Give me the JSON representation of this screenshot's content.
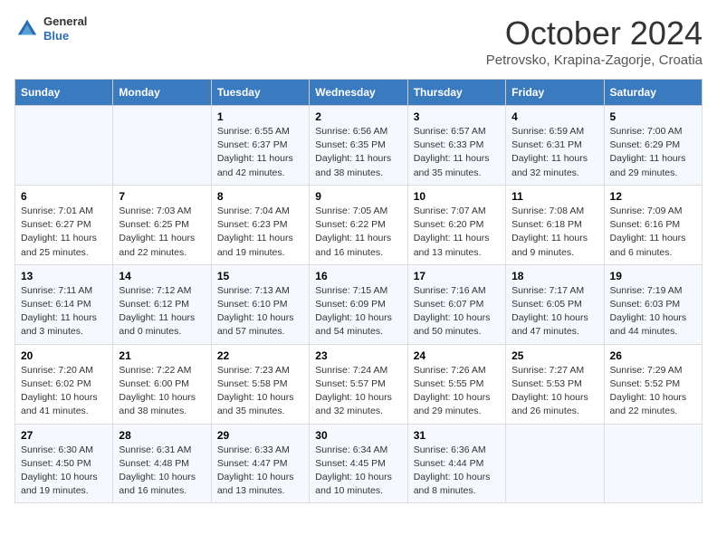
{
  "header": {
    "logo_general": "General",
    "logo_blue": "Blue",
    "month_title": "October 2024",
    "location": "Petrovsko, Krapina-Zagorje, Croatia"
  },
  "days_of_week": [
    "Sunday",
    "Monday",
    "Tuesday",
    "Wednesday",
    "Thursday",
    "Friday",
    "Saturday"
  ],
  "weeks": [
    [
      {
        "day": "",
        "sunrise": "",
        "sunset": "",
        "daylight": ""
      },
      {
        "day": "",
        "sunrise": "",
        "sunset": "",
        "daylight": ""
      },
      {
        "day": "1",
        "sunrise": "Sunrise: 6:55 AM",
        "sunset": "Sunset: 6:37 PM",
        "daylight": "Daylight: 11 hours and 42 minutes."
      },
      {
        "day": "2",
        "sunrise": "Sunrise: 6:56 AM",
        "sunset": "Sunset: 6:35 PM",
        "daylight": "Daylight: 11 hours and 38 minutes."
      },
      {
        "day": "3",
        "sunrise": "Sunrise: 6:57 AM",
        "sunset": "Sunset: 6:33 PM",
        "daylight": "Daylight: 11 hours and 35 minutes."
      },
      {
        "day": "4",
        "sunrise": "Sunrise: 6:59 AM",
        "sunset": "Sunset: 6:31 PM",
        "daylight": "Daylight: 11 hours and 32 minutes."
      },
      {
        "day": "5",
        "sunrise": "Sunrise: 7:00 AM",
        "sunset": "Sunset: 6:29 PM",
        "daylight": "Daylight: 11 hours and 29 minutes."
      }
    ],
    [
      {
        "day": "6",
        "sunrise": "Sunrise: 7:01 AM",
        "sunset": "Sunset: 6:27 PM",
        "daylight": "Daylight: 11 hours and 25 minutes."
      },
      {
        "day": "7",
        "sunrise": "Sunrise: 7:03 AM",
        "sunset": "Sunset: 6:25 PM",
        "daylight": "Daylight: 11 hours and 22 minutes."
      },
      {
        "day": "8",
        "sunrise": "Sunrise: 7:04 AM",
        "sunset": "Sunset: 6:23 PM",
        "daylight": "Daylight: 11 hours and 19 minutes."
      },
      {
        "day": "9",
        "sunrise": "Sunrise: 7:05 AM",
        "sunset": "Sunset: 6:22 PM",
        "daylight": "Daylight: 11 hours and 16 minutes."
      },
      {
        "day": "10",
        "sunrise": "Sunrise: 7:07 AM",
        "sunset": "Sunset: 6:20 PM",
        "daylight": "Daylight: 11 hours and 13 minutes."
      },
      {
        "day": "11",
        "sunrise": "Sunrise: 7:08 AM",
        "sunset": "Sunset: 6:18 PM",
        "daylight": "Daylight: 11 hours and 9 minutes."
      },
      {
        "day": "12",
        "sunrise": "Sunrise: 7:09 AM",
        "sunset": "Sunset: 6:16 PM",
        "daylight": "Daylight: 11 hours and 6 minutes."
      }
    ],
    [
      {
        "day": "13",
        "sunrise": "Sunrise: 7:11 AM",
        "sunset": "Sunset: 6:14 PM",
        "daylight": "Daylight: 11 hours and 3 minutes."
      },
      {
        "day": "14",
        "sunrise": "Sunrise: 7:12 AM",
        "sunset": "Sunset: 6:12 PM",
        "daylight": "Daylight: 11 hours and 0 minutes."
      },
      {
        "day": "15",
        "sunrise": "Sunrise: 7:13 AM",
        "sunset": "Sunset: 6:10 PM",
        "daylight": "Daylight: 10 hours and 57 minutes."
      },
      {
        "day": "16",
        "sunrise": "Sunrise: 7:15 AM",
        "sunset": "Sunset: 6:09 PM",
        "daylight": "Daylight: 10 hours and 54 minutes."
      },
      {
        "day": "17",
        "sunrise": "Sunrise: 7:16 AM",
        "sunset": "Sunset: 6:07 PM",
        "daylight": "Daylight: 10 hours and 50 minutes."
      },
      {
        "day": "18",
        "sunrise": "Sunrise: 7:17 AM",
        "sunset": "Sunset: 6:05 PM",
        "daylight": "Daylight: 10 hours and 47 minutes."
      },
      {
        "day": "19",
        "sunrise": "Sunrise: 7:19 AM",
        "sunset": "Sunset: 6:03 PM",
        "daylight": "Daylight: 10 hours and 44 minutes."
      }
    ],
    [
      {
        "day": "20",
        "sunrise": "Sunrise: 7:20 AM",
        "sunset": "Sunset: 6:02 PM",
        "daylight": "Daylight: 10 hours and 41 minutes."
      },
      {
        "day": "21",
        "sunrise": "Sunrise: 7:22 AM",
        "sunset": "Sunset: 6:00 PM",
        "daylight": "Daylight: 10 hours and 38 minutes."
      },
      {
        "day": "22",
        "sunrise": "Sunrise: 7:23 AM",
        "sunset": "Sunset: 5:58 PM",
        "daylight": "Daylight: 10 hours and 35 minutes."
      },
      {
        "day": "23",
        "sunrise": "Sunrise: 7:24 AM",
        "sunset": "Sunset: 5:57 PM",
        "daylight": "Daylight: 10 hours and 32 minutes."
      },
      {
        "day": "24",
        "sunrise": "Sunrise: 7:26 AM",
        "sunset": "Sunset: 5:55 PM",
        "daylight": "Daylight: 10 hours and 29 minutes."
      },
      {
        "day": "25",
        "sunrise": "Sunrise: 7:27 AM",
        "sunset": "Sunset: 5:53 PM",
        "daylight": "Daylight: 10 hours and 26 minutes."
      },
      {
        "day": "26",
        "sunrise": "Sunrise: 7:29 AM",
        "sunset": "Sunset: 5:52 PM",
        "daylight": "Daylight: 10 hours and 22 minutes."
      }
    ],
    [
      {
        "day": "27",
        "sunrise": "Sunrise: 6:30 AM",
        "sunset": "Sunset: 4:50 PM",
        "daylight": "Daylight: 10 hours and 19 minutes."
      },
      {
        "day": "28",
        "sunrise": "Sunrise: 6:31 AM",
        "sunset": "Sunset: 4:48 PM",
        "daylight": "Daylight: 10 hours and 16 minutes."
      },
      {
        "day": "29",
        "sunrise": "Sunrise: 6:33 AM",
        "sunset": "Sunset: 4:47 PM",
        "daylight": "Daylight: 10 hours and 13 minutes."
      },
      {
        "day": "30",
        "sunrise": "Sunrise: 6:34 AM",
        "sunset": "Sunset: 4:45 PM",
        "daylight": "Daylight: 10 hours and 10 minutes."
      },
      {
        "day": "31",
        "sunrise": "Sunrise: 6:36 AM",
        "sunset": "Sunset: 4:44 PM",
        "daylight": "Daylight: 10 hours and 8 minutes."
      },
      {
        "day": "",
        "sunrise": "",
        "sunset": "",
        "daylight": ""
      },
      {
        "day": "",
        "sunrise": "",
        "sunset": "",
        "daylight": ""
      }
    ]
  ]
}
